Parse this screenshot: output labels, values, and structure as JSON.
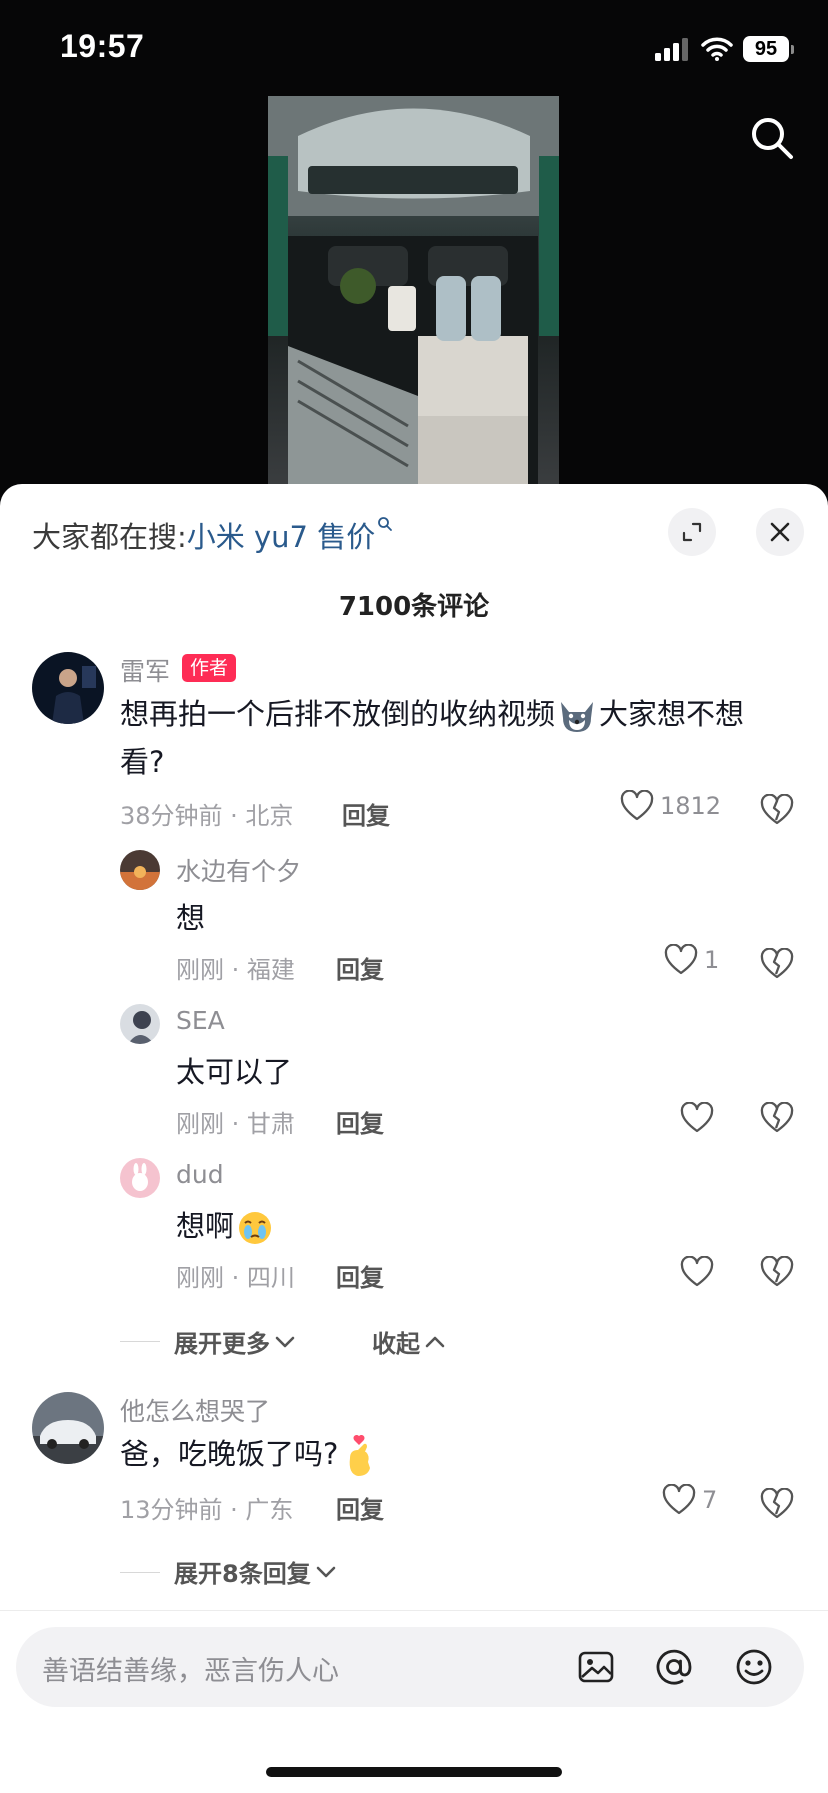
{
  "status": {
    "time": "19:57",
    "battery": "95"
  },
  "hot_search": {
    "prefix": "大家都在搜:",
    "term": "小米 yu7 售价"
  },
  "comment_count": "7100条评论",
  "comments": [
    {
      "user": "雷军",
      "badge": "作者",
      "text_before": "想再拍一个后排不放倒的收纳视频",
      "text_after": "大家想不想看?",
      "time_loc": "38分钟前 · 北京",
      "reply": "回复",
      "likes": "1812"
    },
    {
      "user": "他怎么想哭了",
      "text": "爸，吃晚饭了吗?",
      "time_loc": "13分钟前 · 广东",
      "reply": "回复",
      "likes": "7"
    }
  ],
  "replies": [
    {
      "user": "水边有个夕",
      "text": "想",
      "time_loc": "刚刚 · 福建",
      "reply": "回复",
      "likes": "1"
    },
    {
      "user": "SEA",
      "text": "太可以了",
      "time_loc": "刚刚 · 甘肃",
      "reply": "回复",
      "likes": ""
    },
    {
      "user": "dud",
      "text": "想啊",
      "time_loc": "刚刚 · 四川",
      "reply": "回复",
      "likes": ""
    }
  ],
  "thread_actions": {
    "expand_more": "展开更多",
    "collapse": "收起",
    "expand_replies": "展开8条回复"
  },
  "input": {
    "placeholder": "善语结善缘，恶言伤人心"
  },
  "colors": {
    "accent_red": "#fe2c55",
    "link_blue": "#2a5a8c"
  },
  "icons": [
    "signal-icon",
    "wifi-icon",
    "battery-icon",
    "search-icon",
    "expand-icon",
    "close-icon",
    "heart-icon",
    "broken-heart-icon",
    "chevron-down-icon",
    "chevron-up-icon",
    "image-icon",
    "at-icon",
    "emoji-icon"
  ]
}
